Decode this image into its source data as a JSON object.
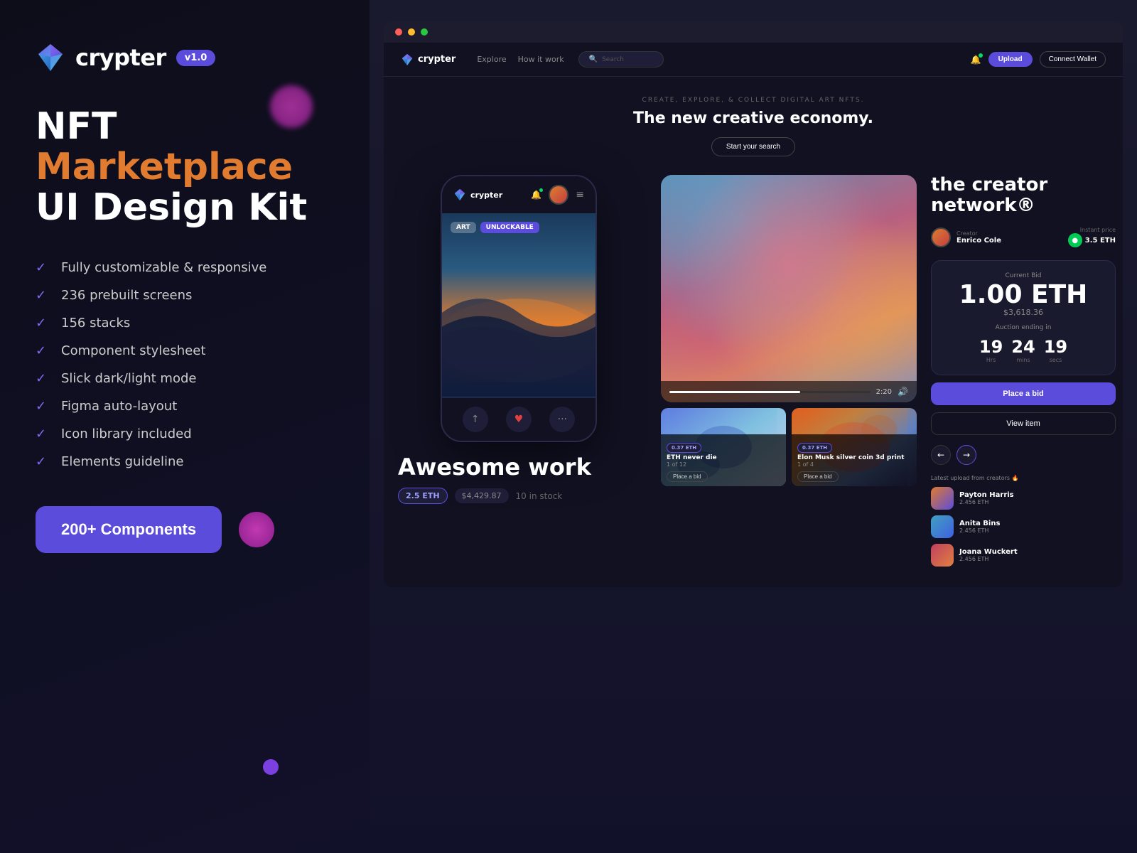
{
  "left": {
    "logo_text": "crypter",
    "version": "v1.0",
    "title_line1": "NFT ",
    "title_marketplace": "Marketplace",
    "title_line2": "UI Design Kit",
    "features": [
      "Fully customizable & responsive",
      "236 prebuilt screens",
      "156 stacks",
      "Component stylesheet",
      "Slick dark/light mode",
      "Figma auto-layout",
      "Icon library included",
      "Elements guideline"
    ],
    "cta_label": "200+ Components"
  },
  "right": {
    "nav": {
      "logo": "crypter",
      "links": [
        "Explore",
        "How it work"
      ],
      "search_placeholder": "Search",
      "upload_label": "Upload",
      "connect_label": "Connect Wallet"
    },
    "hero": {
      "subtitle": "CREATE, EXPLORE, & COLLECT DIGITAL ART NFTS.",
      "title": "The new creative economy.",
      "cta": "Start your search"
    },
    "mobile": {
      "logo": "crypter",
      "nft_tags": [
        "ART",
        "UNLOCKABLE"
      ],
      "actions": [
        "share",
        "heart",
        "more"
      ]
    },
    "nft_info": {
      "title": "Awesome work",
      "eth_price": "2.5 ETH",
      "usd_price": "$4,429.87",
      "stock": "10 in stock"
    },
    "art_items": [
      {
        "title": "ETH never die",
        "eth": "0.37 ETH",
        "count": "1 of 12",
        "action": "Place a bid"
      },
      {
        "title": "Elon Musk silver coin 3d print",
        "eth": "0.37 ETH",
        "count": "1 of 4",
        "action": "Place a bid"
      }
    ],
    "creator": {
      "network_title": "the creator\nnetwork®",
      "creator_label": "Creator",
      "creator_name": "Enrico Cole",
      "instant_price_label": "Instant price",
      "instant_price": "3.5 ETH"
    },
    "bid": {
      "label": "Current Bid",
      "amount": "1.00 ETH",
      "usd": "$3,618.36",
      "auction_label": "Auction ending in",
      "hours": "19",
      "mins": "24",
      "secs": "19",
      "hrs_label": "Hrs",
      "mins_label": "mins",
      "secs_label": "secs",
      "place_bid": "Place a bid",
      "view_item": "View item"
    },
    "latest_uploads": {
      "title": "Latest upload from creators 🔥",
      "creators": [
        {
          "name": "Payton Harris",
          "eth": "2.456 ETH"
        },
        {
          "name": "Anita Bins",
          "eth": "2.456 ETH"
        },
        {
          "name": "Joana Wuckert",
          "eth": "2.456 ETH"
        }
      ]
    },
    "video_time": "2:20"
  }
}
